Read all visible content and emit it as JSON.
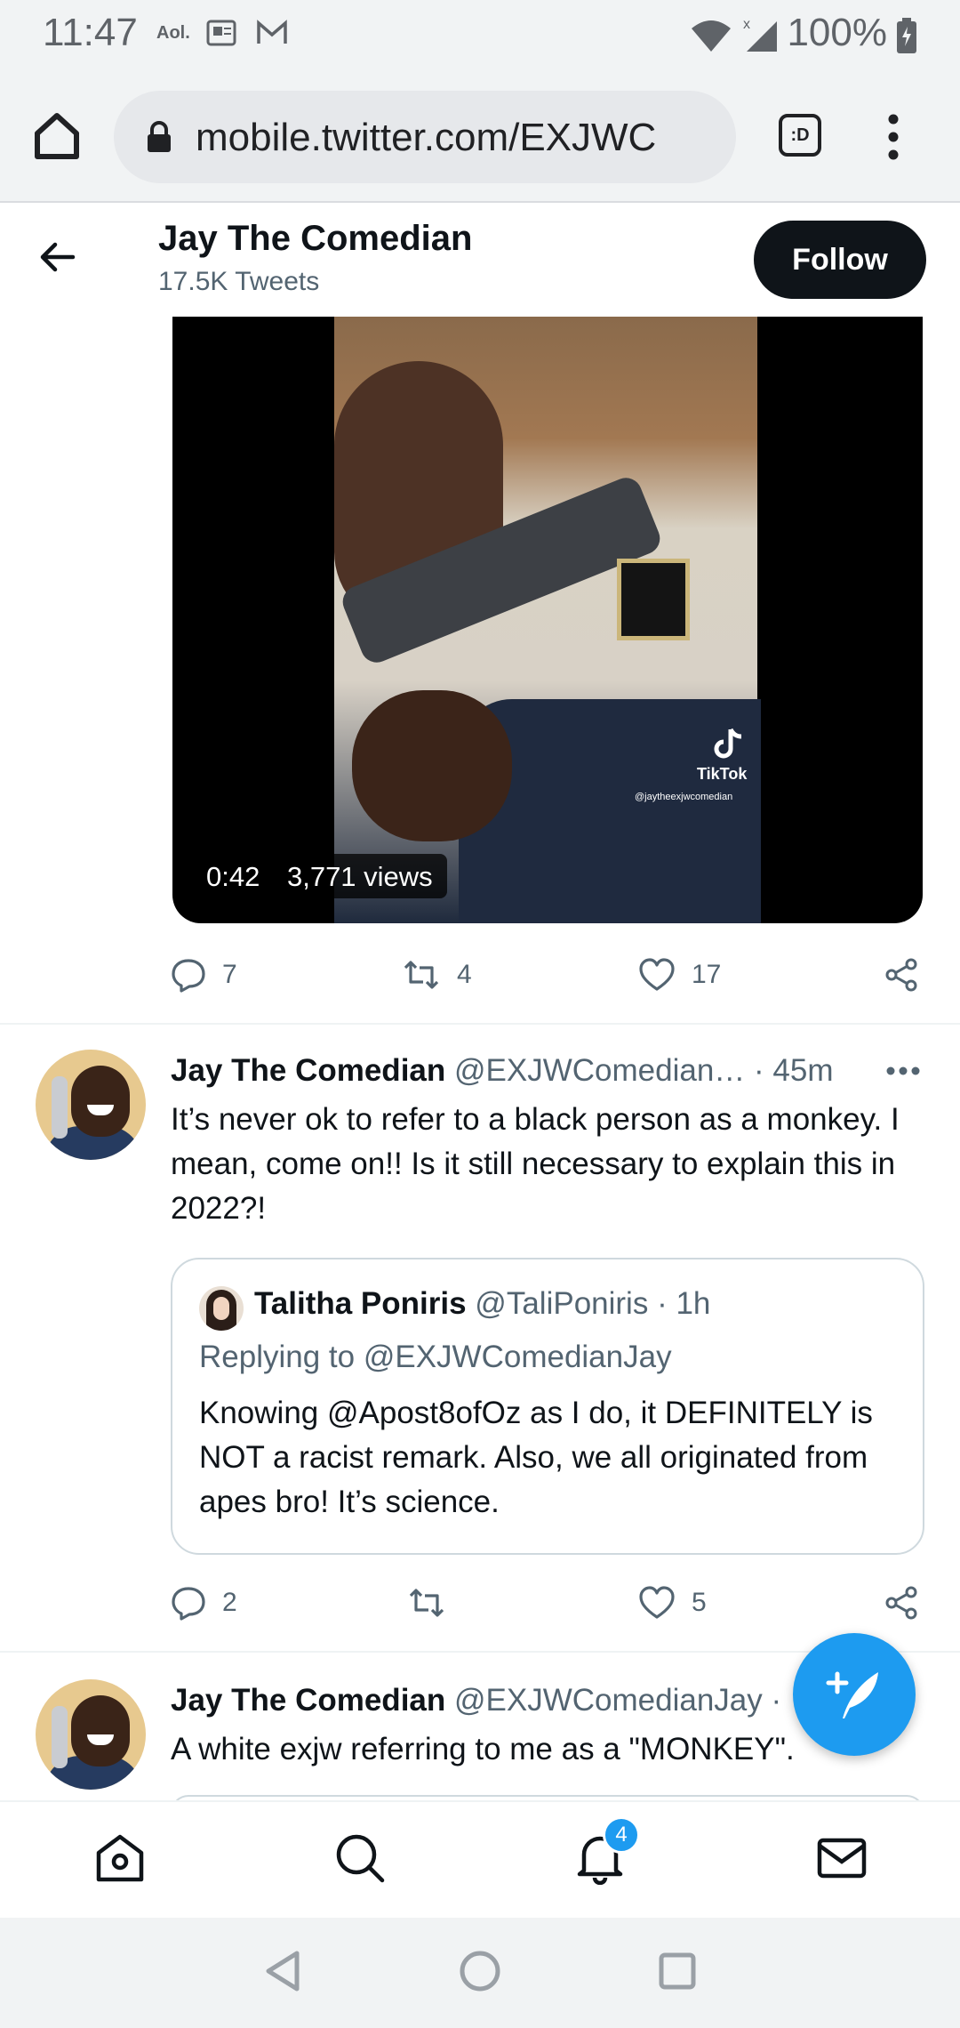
{
  "status_bar": {
    "time": "11:47",
    "notif_aol": "Aol.",
    "battery": "100%"
  },
  "browser": {
    "url": "mobile.twitter.com/EXJWC",
    "tab_switcher_label": ":D"
  },
  "profile": {
    "name": "Jay The Comedian",
    "tweet_count": "17.5K Tweets",
    "follow_label": "Follow"
  },
  "video": {
    "duration": "0:42",
    "views": "3,771 views",
    "watermark": "TikTok",
    "watermark_handle": "@jaytheexjwcomedian"
  },
  "tweet1_actions": {
    "replies": "7",
    "retweets": "4",
    "likes": "17"
  },
  "tweet2": {
    "name": "Jay The Comedian",
    "handle": "@EXJWComedian…",
    "time": "· 45m",
    "text": "It’s never ok to refer to a black person as a monkey. I mean, come on!! Is it still necessary to explain this in 2022?!",
    "quote": {
      "name": "Talitha Poniris",
      "handle": "@TaliPoniris",
      "time": "· 1h",
      "replying_to": "Replying to @EXJWComedianJay",
      "text": "Knowing @Apost8ofOz as I do, it DEFINITELY is NOT a racist remark. Also, we all originated from apes bro! It’s science."
    },
    "actions": {
      "replies": "2",
      "retweets": "",
      "likes": "5"
    }
  },
  "tweet3": {
    "name": "Jay The Comedian",
    "handle": "@EXJWComedianJay ·",
    "text": "A white exjw referring to me as a \"MONKEY\"."
  },
  "bottom_nav": {
    "notifications_badge": "4"
  },
  "colors": {
    "accent": "#1d9bf0",
    "text_primary": "#0f1419",
    "text_secondary": "#536471",
    "follow_bg": "#0f1419"
  }
}
